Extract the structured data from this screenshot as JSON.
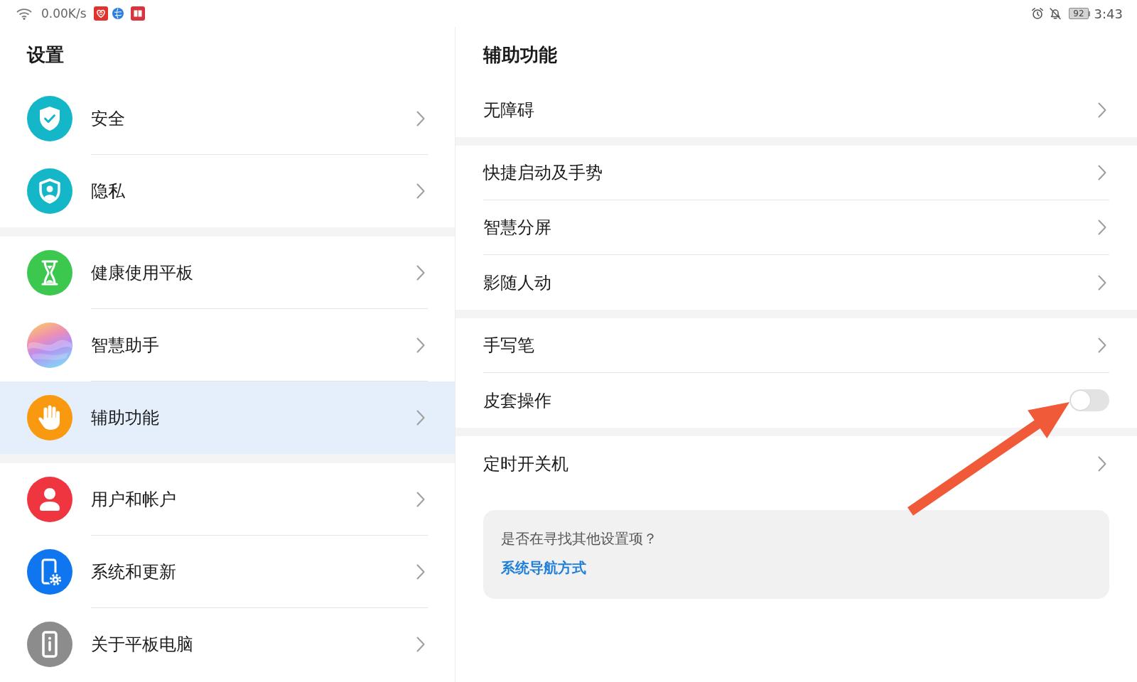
{
  "status_bar": {
    "net_speed": "0.00K/s",
    "battery": "92",
    "time": "3:43"
  },
  "sidebar": {
    "title": "设置",
    "groups": [
      {
        "items": [
          {
            "label": "安全",
            "selected": false
          },
          {
            "label": "隐私",
            "selected": false
          }
        ]
      },
      {
        "items": [
          {
            "label": "健康使用平板",
            "selected": false
          },
          {
            "label": "智慧助手",
            "selected": false
          },
          {
            "label": "辅助功能",
            "selected": true
          }
        ]
      },
      {
        "items": [
          {
            "label": "用户和帐户",
            "selected": false
          },
          {
            "label": "系统和更新",
            "selected": false
          },
          {
            "label": "关于平板电脑",
            "selected": false
          }
        ]
      }
    ]
  },
  "detail": {
    "title": "辅助功能",
    "groups": [
      {
        "items": [
          {
            "label": "无障碍",
            "kind": "link",
            "arrow_callout": false
          }
        ]
      },
      {
        "items": [
          {
            "label": "快捷启动及手势",
            "kind": "link",
            "arrow_callout": false
          },
          {
            "label": "智慧分屏",
            "kind": "link",
            "arrow_callout": false
          },
          {
            "label": "影随人动",
            "kind": "link",
            "arrow_callout": false
          }
        ]
      },
      {
        "items": [
          {
            "label": "手写笔",
            "kind": "link",
            "arrow_callout": false
          },
          {
            "label": "皮套操作",
            "kind": "switch",
            "on": false,
            "arrow_callout": true
          }
        ]
      },
      {
        "items": [
          {
            "label": "定时开关机",
            "kind": "link",
            "arrow_callout": false
          }
        ]
      }
    ],
    "suggestion": {
      "question": "是否在寻找其他设置项？",
      "link": "系统导航方式"
    }
  }
}
